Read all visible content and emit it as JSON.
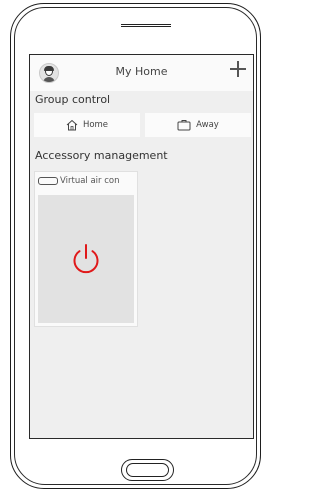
{
  "header": {
    "title": "My Home"
  },
  "group_control": {
    "label": "Group control",
    "buttons": [
      {
        "label": "Home",
        "icon": "home-icon"
      },
      {
        "label": "Away",
        "icon": "suitcase-icon"
      }
    ]
  },
  "accessory_management": {
    "label": "Accessory management",
    "devices": [
      {
        "name": "Virtual air con",
        "icon": "air-conditioner-icon",
        "power_icon": "power-icon",
        "power_color": "#e0191a"
      }
    ]
  },
  "colors": {
    "screen_bg": "#efefef",
    "power_off": "#e0191a"
  }
}
